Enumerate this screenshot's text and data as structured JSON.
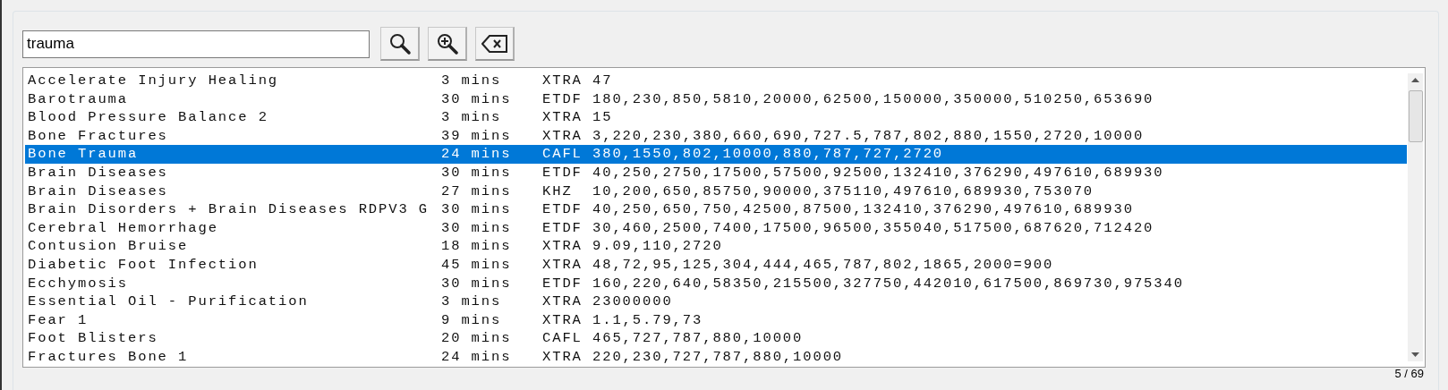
{
  "search": {
    "value": "trauma"
  },
  "buttons": [
    {
      "kind": "search"
    },
    {
      "kind": "zoom"
    },
    {
      "kind": "clear"
    }
  ],
  "list": {
    "rows": [
      {
        "name": "Accelerate Injury Healing",
        "duration": "3 mins",
        "mode": "XTRA",
        "frequencies": "47",
        "selected": false
      },
      {
        "name": "Barotrauma",
        "duration": "30 mins",
        "mode": "ETDF",
        "frequencies": "180,230,850,5810,20000,62500,150000,350000,510250,653690",
        "selected": false
      },
      {
        "name": "Blood Pressure Balance 2",
        "duration": "3 mins",
        "mode": "XTRA",
        "frequencies": "15",
        "selected": false
      },
      {
        "name": "Bone Fractures",
        "duration": "39 mins",
        "mode": "XTRA",
        "frequencies": "3,220,230,380,660,690,727.5,787,802,880,1550,2720,10000",
        "selected": false
      },
      {
        "name": "Bone Trauma",
        "duration": "24 mins",
        "mode": "CAFL",
        "frequencies": "380,1550,802,10000,880,787,727,2720",
        "selected": true
      },
      {
        "name": "Brain Diseases",
        "duration": "30 mins",
        "mode": "ETDF",
        "frequencies": "40,250,2750,17500,57500,92500,132410,376290,497610,689930",
        "selected": false
      },
      {
        "name": "Brain Diseases",
        "duration": "27 mins",
        "mode": "KHZ",
        "frequencies": "10,200,650,85750,90000,375110,497610,689930,753070",
        "selected": false
      },
      {
        "name": "Brain Disorders + Brain Diseases RDPV3 G",
        "duration": "30 mins",
        "mode": "ETDF",
        "frequencies": "40,250,650,750,42500,87500,132410,376290,497610,689930",
        "selected": false
      },
      {
        "name": "Cerebral Hemorrhage",
        "duration": "30 mins",
        "mode": "ETDF",
        "frequencies": "30,460,2500,7400,17500,96500,355040,517500,687620,712420",
        "selected": false
      },
      {
        "name": "Contusion Bruise",
        "duration": "18 mins",
        "mode": "XTRA",
        "frequencies": "9.09,110,2720",
        "selected": false
      },
      {
        "name": "Diabetic Foot Infection",
        "duration": "45 mins",
        "mode": "XTRA",
        "frequencies": "48,72,95,125,304,444,465,787,802,1865,2000=900",
        "selected": false
      },
      {
        "name": "Ecchymosis",
        "duration": "30 mins",
        "mode": "ETDF",
        "frequencies": "160,220,640,58350,215500,327750,442010,617500,869730,975340",
        "selected": false
      },
      {
        "name": "Essential Oil - Purification",
        "duration": "3 mins",
        "mode": "XTRA",
        "frequencies": "23000000",
        "selected": false
      },
      {
        "name": "Fear 1",
        "duration": "9 mins",
        "mode": "XTRA",
        "frequencies": "1.1,5.79,73",
        "selected": false
      },
      {
        "name": "Foot Blisters",
        "duration": "20 mins",
        "mode": "CAFL",
        "frequencies": "465,727,787,880,10000",
        "selected": false
      },
      {
        "name": "Fractures Bone 1",
        "duration": "24 mins",
        "mode": "XTRA",
        "frequencies": "220,230,727,787,880,10000",
        "selected": false
      }
    ]
  },
  "status": {
    "count": "5 / 69"
  }
}
